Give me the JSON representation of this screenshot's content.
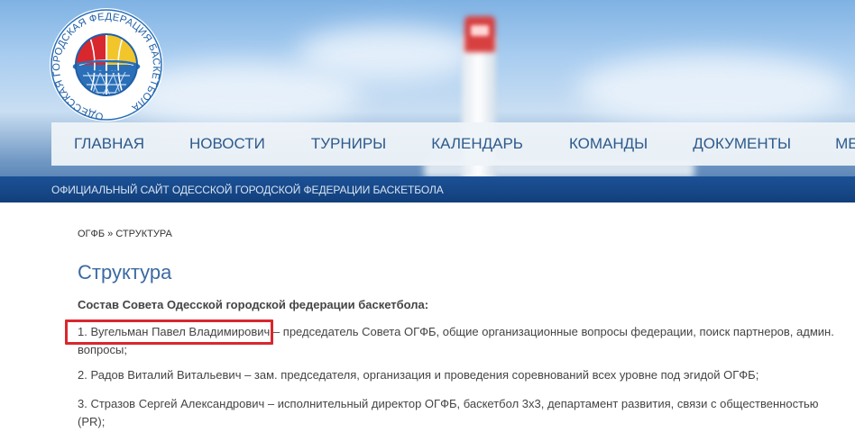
{
  "logo": {
    "arc_text": "ОДЕССКАЯ ГОРОДСКАЯ ФЕДЕРАЦИЯ БАСКЕТБОЛА",
    "colors": {
      "red": "#d9272e",
      "yellow": "#f2c62b",
      "blue": "#2a6fb7"
    }
  },
  "nav": {
    "items": [
      {
        "label": "ГЛАВНАЯ"
      },
      {
        "label": "НОВОСТИ"
      },
      {
        "label": "ТУРНИРЫ"
      },
      {
        "label": "КАЛЕНДАРЬ"
      },
      {
        "label": "КОМАНДЫ"
      },
      {
        "label": "ДОКУМЕНТЫ"
      },
      {
        "label": "МЕДИА"
      }
    ]
  },
  "tagline": "ОФИЦИАЛЬНЫЙ САЙТ ОДЕССКОЙ ГОРОДСКОЙ ФЕДЕРАЦИИ БАСКЕТБОЛА",
  "breadcrumb": {
    "home": "ОГФБ",
    "separator": " » ",
    "current": "СТРУКТУРА"
  },
  "page_title": "Структура",
  "section_heading": "Состав Совета Одесской городской федерации баскетбола:",
  "members": [
    {
      "number": "1.",
      "name": "Вугельман Павел Владимирович",
      "role": " – председатель Совета ОГФБ, общие организационные вопросы федерации, поиск партнеров, админ. вопросы;"
    },
    {
      "number": "2.",
      "name": "Радов Виталий Витальевич",
      "role": " – зам. председателя, организация и проведения соревнований всех уровне под эгидой ОГФБ;"
    },
    {
      "number": "3.",
      "name": "Стразов Сергей Александрович",
      "role": " – исполнительный директор ОГФБ, баскетбол 3х3, департамент развития, связи с общественностью (PR);"
    }
  ],
  "colors": {
    "nav_text": "#2d5a8c",
    "tagline_bar": "#1c5196",
    "title": "#3b6aa3",
    "highlight_box": "#d9272e"
  }
}
